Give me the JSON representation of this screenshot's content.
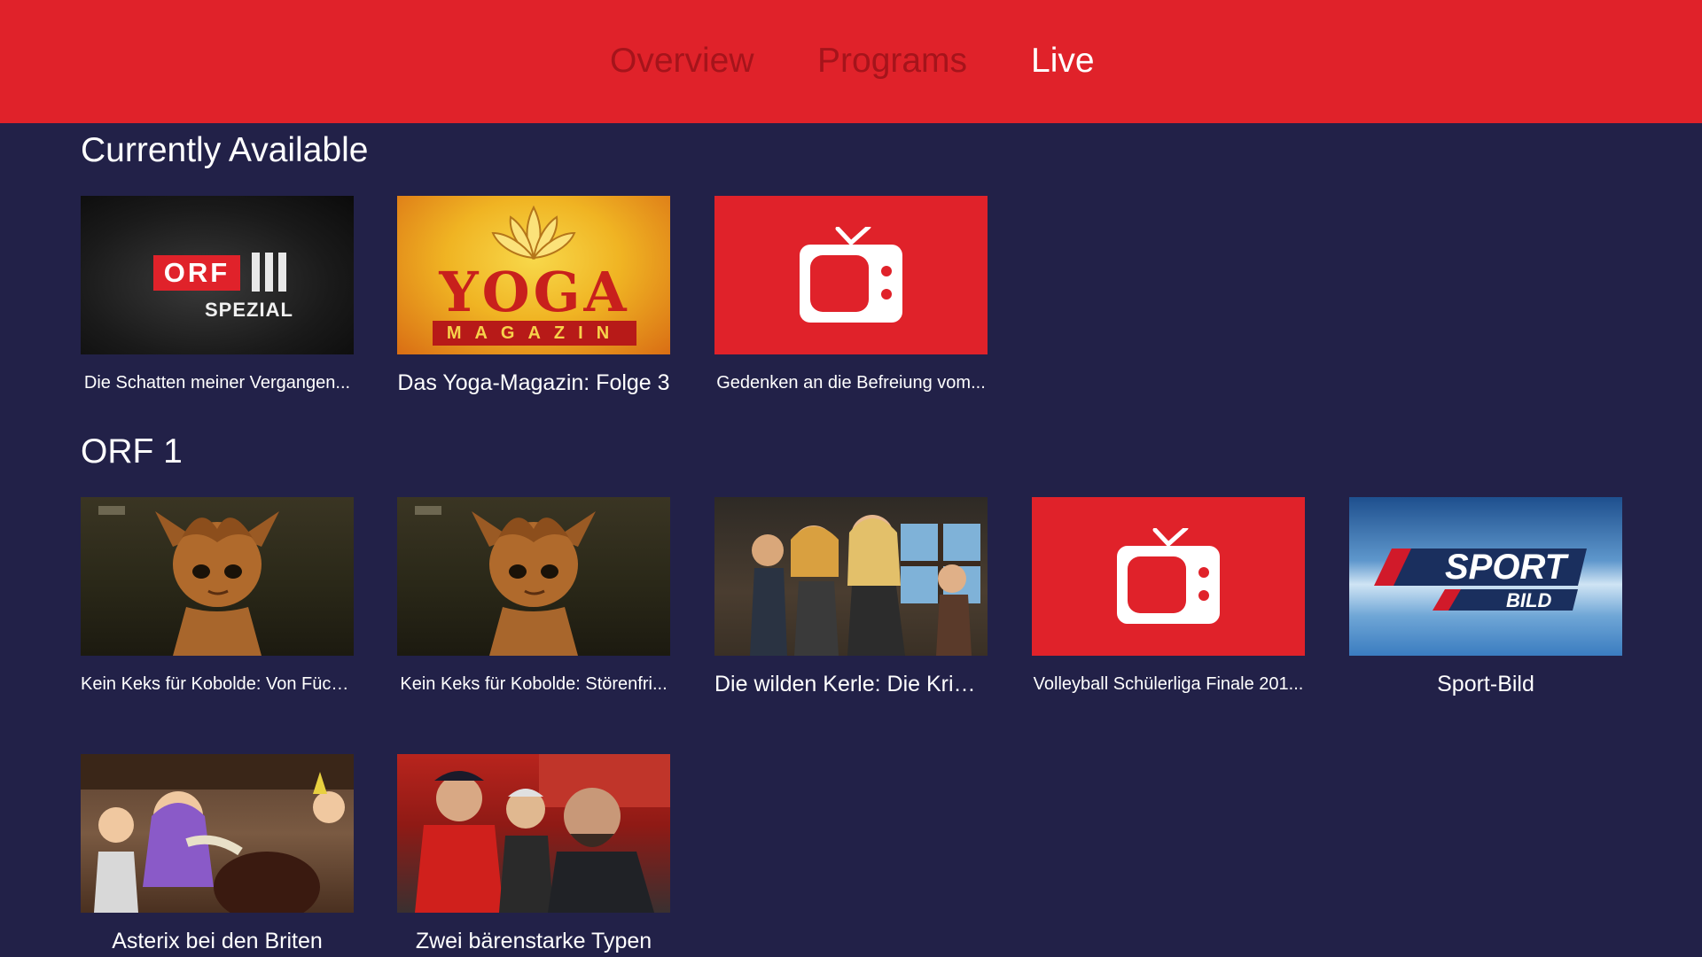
{
  "nav": {
    "tabs": [
      {
        "label": "Overview",
        "active": false
      },
      {
        "label": "Programs",
        "active": false
      },
      {
        "label": "Live",
        "active": true
      }
    ]
  },
  "colors": {
    "topbar": "#e0222a",
    "tab_inactive": "#a5141b",
    "tab_active": "#ffffff",
    "background": "#222148",
    "placeholder": "#e0222a"
  },
  "sections": [
    {
      "title": "Currently Available",
      "items": [
        {
          "caption": "Die Schatten meiner Vergangen...",
          "thumb": "orf-iii-spezial-logo",
          "logo_text": "ORF",
          "logo_sub": "SPEZIAL"
        },
        {
          "caption": "Das Yoga-Magazin: Folge 3",
          "thumb": "yoga-magazin-logo",
          "logo_text": "YOGA",
          "logo_sub": "MAGAZIN"
        },
        {
          "caption": "Gedenken an die Befreiung vom...",
          "thumb": "tv-icon"
        }
      ]
    },
    {
      "title": "ORF 1",
      "items": [
        {
          "caption": "Kein Keks für Kobolde: Von Füch...",
          "thumb": "cartoon-kobold"
        },
        {
          "caption": "Kein Keks für Kobolde: Störenfri...",
          "thumb": "cartoon-kobold"
        },
        {
          "caption": "Die wilden Kerle: Die Kriegerin",
          "thumb": "cartoon-kids"
        },
        {
          "caption": "Volleyball Schülerliga Finale 201...",
          "thumb": "tv-icon"
        },
        {
          "caption": "Sport-Bild",
          "thumb": "sport-bild-logo",
          "logo_text": "SPORT",
          "logo_sub": "BILD"
        },
        {
          "caption": "Asterix bei den Briten",
          "thumb": "cartoon-asterix"
        },
        {
          "caption": "Zwei bärenstarke Typen",
          "thumb": "photo-actors"
        }
      ]
    }
  ]
}
